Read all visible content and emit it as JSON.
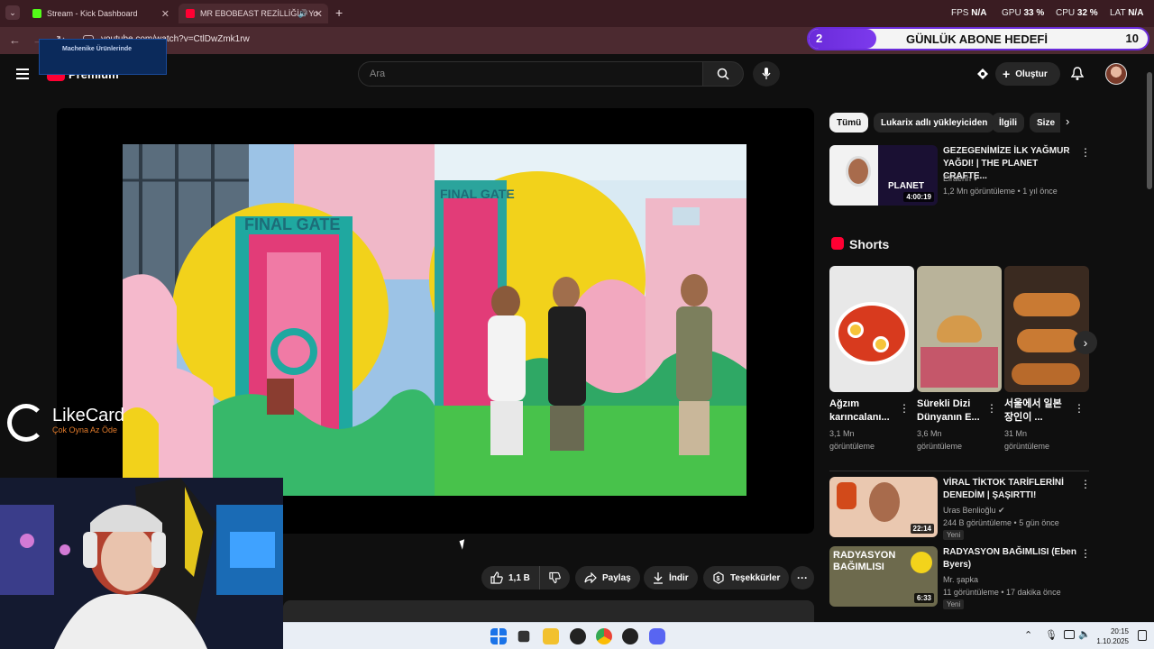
{
  "browser": {
    "tabs": [
      {
        "title": "Stream - Kick Dashboard",
        "favicon_color": "#53fc18"
      },
      {
        "title": "MR EBOBEAST REZİLLİĞİ. - Yo",
        "favicon_color": "#ff0033"
      }
    ],
    "new_tab": "+",
    "stats": [
      {
        "label": "FPS",
        "value": "N/A"
      },
      {
        "label": "GPU",
        "value": "33 %"
      },
      {
        "label": "CPU",
        "value": "32 %"
      },
      {
        "label": "LAT",
        "value": "N/A"
      }
    ],
    "url": "youtube.com/watch?v=CtlDwZmk1rw"
  },
  "goal": {
    "current": "2",
    "label": "GÜNLÜK ABONE HEDEFİ",
    "target": "10",
    "progress": 0.2
  },
  "promo": {
    "text": "Machenike Ürünlerinde"
  },
  "youtube": {
    "logo_text": "Premium",
    "search_placeholder": "Ara",
    "create_label": "Oluştur"
  },
  "actions": {
    "like_count": "1,1 B",
    "share": "Paylaş",
    "download": "İndir",
    "thanks": "Teşekkürler"
  },
  "overlay": {
    "brand": "LikeCard",
    "tagline": "Çok Oyna  Az Öde"
  },
  "chips": [
    "Tümü",
    "Lukarix adlı yükleyiciden",
    "İlgili",
    "Size"
  ],
  "recommended_top": {
    "title": "GEZEGENİMİZE İLK YAĞMUR YAĞDI! | THE PLANET CRAFTE...",
    "channel": "Elraenn",
    "meta": "1,2 Mn görüntüleme • 1 yıl önce",
    "duration": "4:00:19",
    "thumb_text": "PLANET"
  },
  "shorts": {
    "heading": "Shorts",
    "items": [
      {
        "title": "Ağzım karıncalanı...",
        "views": "3,1 Mn",
        "views_label": "görüntüleme"
      },
      {
        "title": "Sürekli Dizi Dünyanın E...",
        "views": "3,6 Mn",
        "views_label": "görüntüleme"
      },
      {
        "title": "서울에서 일본 장인이 ...",
        "views": "31 Mn",
        "views_label": "görüntüleme"
      }
    ]
  },
  "recommended": [
    {
      "title": "VİRAL TİKTOK TARİFLERİNİ DENEDİM | ŞAŞIRTTI!",
      "channel": "Uras Benlioğlu",
      "meta": "244 B görüntüleme • 5 gün önce",
      "badge": "Yeni",
      "duration": "22:14"
    },
    {
      "title": "RADYASYON BAĞIMLISI (Eben Byers)",
      "channel": "Mr. şapka",
      "meta": "11 görüntüleme • 17 dakika önce",
      "badge": "Yeni",
      "duration": "6:33",
      "thumb_text": "RADYASYON BAĞIMLISI"
    }
  ],
  "taskbar": {
    "time": "20:15",
    "date": "1.10.2025"
  }
}
